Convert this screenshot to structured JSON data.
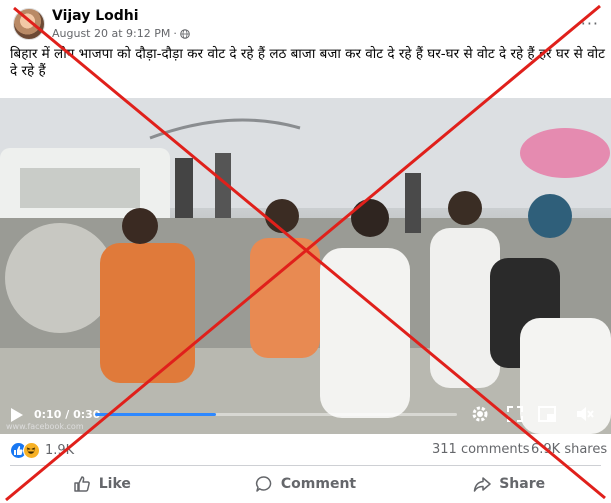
{
  "post": {
    "author": "Vijay Lodhi",
    "timestamp": "August 20 at 9:12 PM",
    "separator": "·",
    "more": "···",
    "caption": "बिहार में लोग भाजपा को दौड़ा-दौड़ा कर वोट दे रहे हैं लठ बाजा  बजा कर वोट दे रहे हैं घर-घर से वोट दे रहे हैं हर घर से वोट दे रहे हैं"
  },
  "video": {
    "current_time": "0:10",
    "time_separator": " / ",
    "duration": "0:30",
    "progress_fraction": 0.333,
    "watermark": "www.facebook.com"
  },
  "stats": {
    "reaction_count": "1.9K",
    "comments": "311 comments",
    "shares": "6.9K shares"
  },
  "actions": {
    "like": "Like",
    "comment": "Comment",
    "share": "Share"
  },
  "colors": {
    "accent": "#1877f2",
    "progress": "#2d88ff",
    "cross": "#e0201b",
    "muted_text": "#65676b"
  },
  "icons": [
    "globe-icon",
    "more-icon",
    "play-icon",
    "settings-icon",
    "fullscreen-icon",
    "pip-icon",
    "volume-icon",
    "like-icon",
    "comment-icon",
    "share-icon"
  ]
}
